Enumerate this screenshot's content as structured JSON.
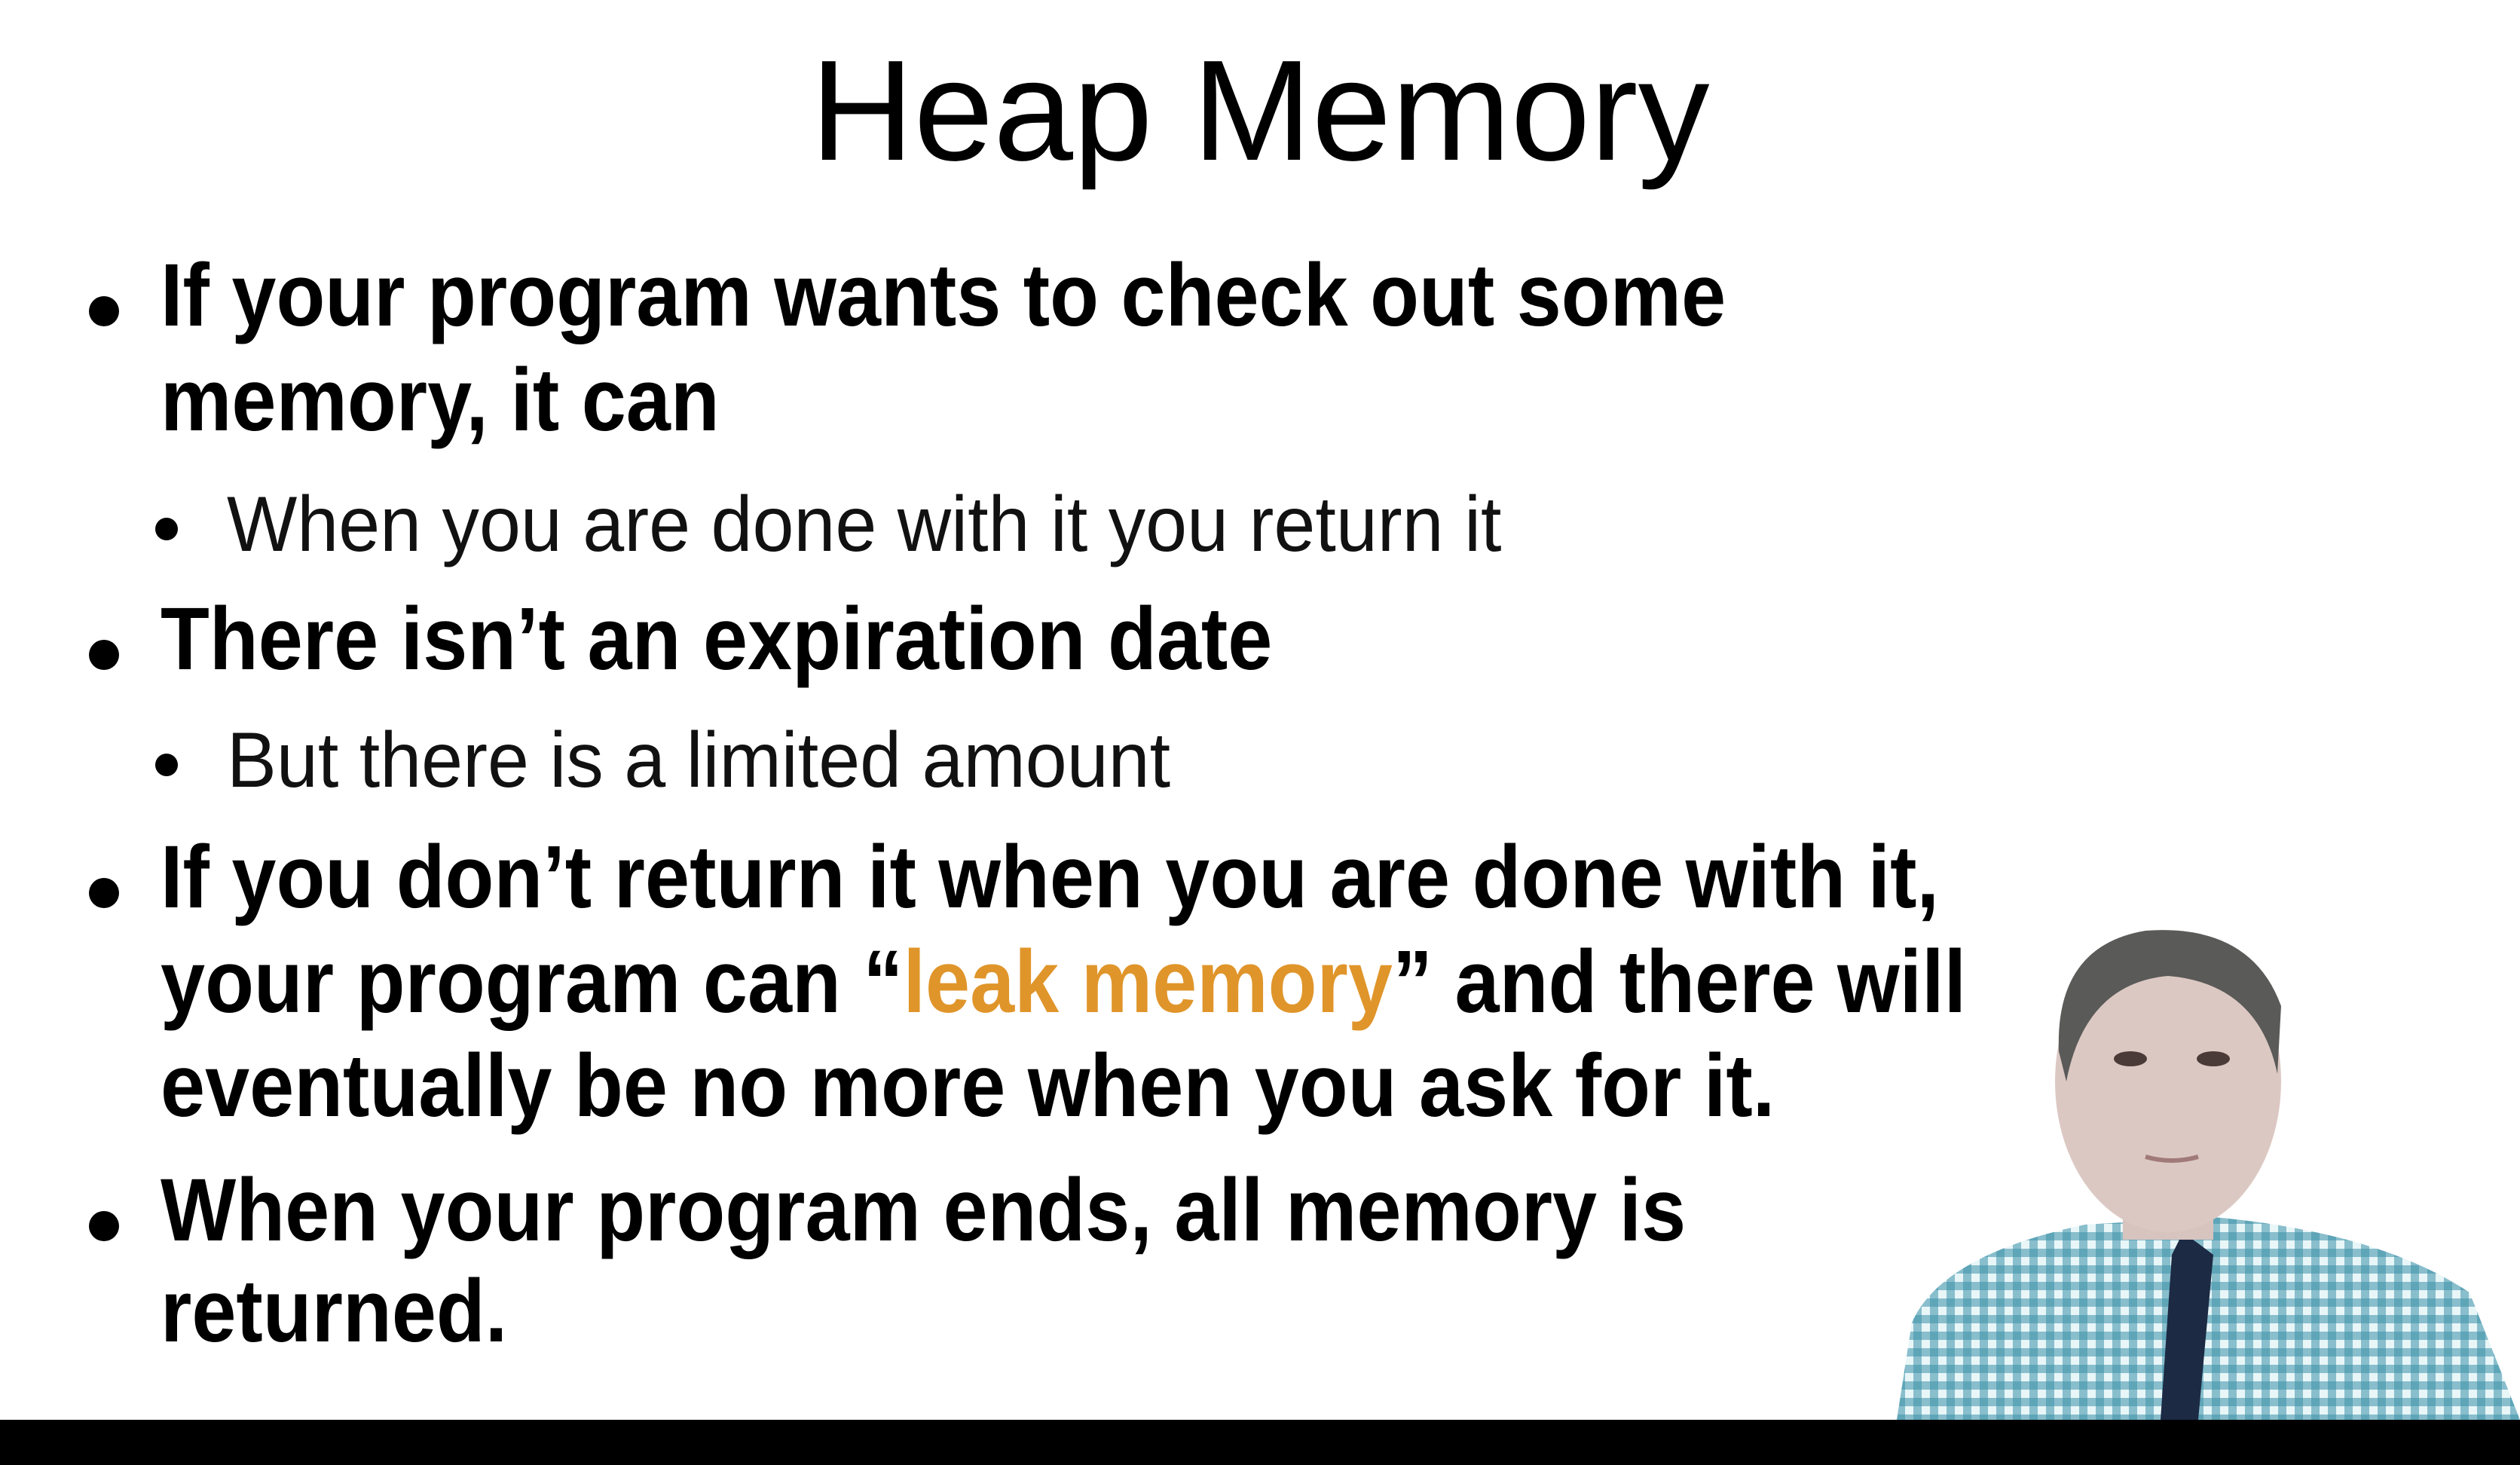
{
  "slide": {
    "title": "Heap Memory",
    "bullets": [
      {
        "lines": [
          "If your program wants to check out some",
          "memory, it can"
        ]
      },
      {
        "sub": "When you are done with it you return it"
      },
      {
        "lines": [
          "There isn’t an expiration date"
        ]
      },
      {
        "sub": "But there is a limited amount"
      },
      {
        "line1": "If you don’t return it when you are done with it,",
        "line2_pre": "your program can “",
        "line2_highlight": "leak memory",
        "line2_post": "” and there will",
        "line3": "eventually be no more when you ask for it."
      },
      {
        "lines": [
          "When your program ends, all memory is",
          "returned."
        ]
      }
    ],
    "highlight_color": "#e0952a"
  }
}
